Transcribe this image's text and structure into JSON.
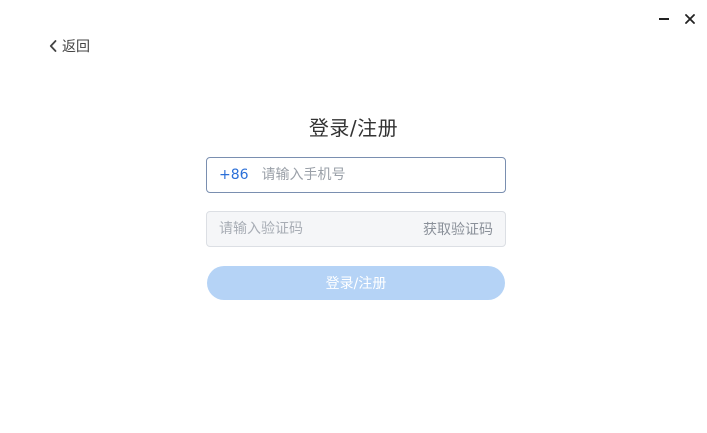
{
  "window_controls": {
    "minimize_icon": "minimize-icon",
    "close_icon": "close-icon"
  },
  "nav": {
    "back_label": "返回",
    "back_icon": "chevron-left-icon"
  },
  "login": {
    "title": "登录/注册",
    "phone": {
      "country_code": "+86",
      "value": "",
      "placeholder": "请输入手机号"
    },
    "code": {
      "value": "",
      "placeholder": "请输入验证码",
      "get_code_label": "获取验证码"
    },
    "submit_label": "登录/注册"
  },
  "colors": {
    "accent": "#2b6fd8",
    "submit_disabled_bg": "#b5d3f6",
    "phone_border": "#7a8fb0",
    "code_bg": "#f5f6f8"
  }
}
